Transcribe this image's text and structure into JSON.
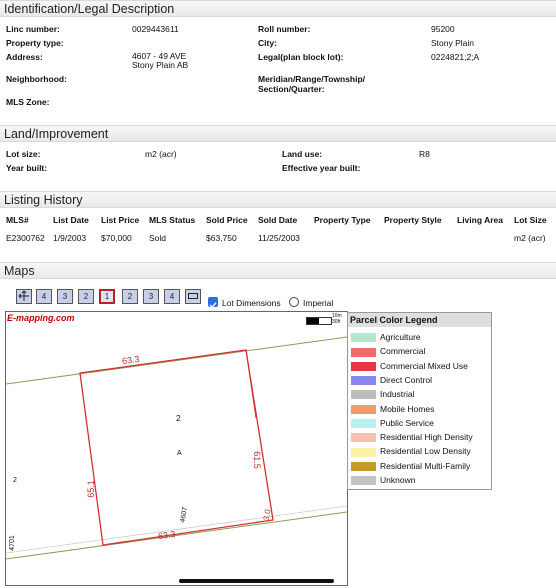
{
  "identification": {
    "title": "Identification/Legal Description",
    "linc_label": "Linc number:",
    "linc_value": "0029443611",
    "roll_label": "Roll number:",
    "roll_value": "95200",
    "ptype_label": "Property type:",
    "city_label": "City:",
    "city_value": "Stony Plain",
    "address_label": "Address:",
    "address_line1": "4607 - 49 AVE",
    "address_line2": "Stony Plain AB",
    "legal_label": "Legal(plan block lot):",
    "legal_value": "0224821;2;A",
    "neigh_label": "Neighborhood:",
    "mrts_label1": "Meridian/Range/Township/",
    "mrts_label2": "Section/Quarter:",
    "mls_zone_label": "MLS Zone:"
  },
  "land": {
    "title": "Land/Improvement",
    "lot_size_label": "Lot size:",
    "lot_size_value": "m2 (acr)",
    "land_use_label": "Land use:",
    "land_use_value": "R8",
    "year_built_label": "Year built:",
    "eff_year_label": "Effective year built:"
  },
  "listing": {
    "title": "Listing History",
    "headers": [
      "MLS#",
      "List Date",
      "List Price",
      "MLS Status",
      "Sold Price",
      "Sold Date",
      "Property Type",
      "Property Style",
      "Living Area",
      "Lot Size"
    ],
    "rows": [
      [
        "E2300762",
        "1/9/2003",
        "$70,000",
        "Sold",
        "$63,750",
        "11/25/2003",
        "",
        "",
        "",
        "m2 (acr)"
      ]
    ]
  },
  "maps": {
    "title": "Maps",
    "toolbar": [
      "pan",
      "4",
      "3",
      "2",
      "1",
      "2",
      "3",
      "4",
      "rect"
    ],
    "lot_dimensions_label": "Lot Dimensions",
    "lot_dimensions_checked": true,
    "imperial_label": "Imperial",
    "imperial_checked": false,
    "brand": "E-mapping.com",
    "scale_top": "10m",
    "scale_bottom": "30ft",
    "lot_labels": {
      "top": "63.3",
      "bottom": "63.3",
      "right": "61.5",
      "left": "65.1",
      "corner": "3.0",
      "civic": "4607",
      "block": "2",
      "lot": "A",
      "west_lot": "2",
      "west_civic": "4701"
    }
  },
  "legend": {
    "title": "Parcel Color Legend",
    "items": [
      {
        "label": "Agriculture",
        "color": "#b8e6cc"
      },
      {
        "label": "Commercial",
        "color": "#f26a6a"
      },
      {
        "label": "Commercial Mixed Use",
        "color": "#ee3344"
      },
      {
        "label": "Direct Control",
        "color": "#8a86f0"
      },
      {
        "label": "Industrial",
        "color": "#bdbdbd"
      },
      {
        "label": "Mobile Homes",
        "color": "#f29a6e"
      },
      {
        "label": "Public Service",
        "color": "#b6f1ee"
      },
      {
        "label": "Residential High Density",
        "color": "#f7c2b4"
      },
      {
        "label": "Residential Low Density",
        "color": "#fbf3a8"
      },
      {
        "label": "Residential Multi-Family",
        "color": "#c89b28"
      },
      {
        "label": "Unknown",
        "color": "#c4c4c4"
      }
    ]
  }
}
